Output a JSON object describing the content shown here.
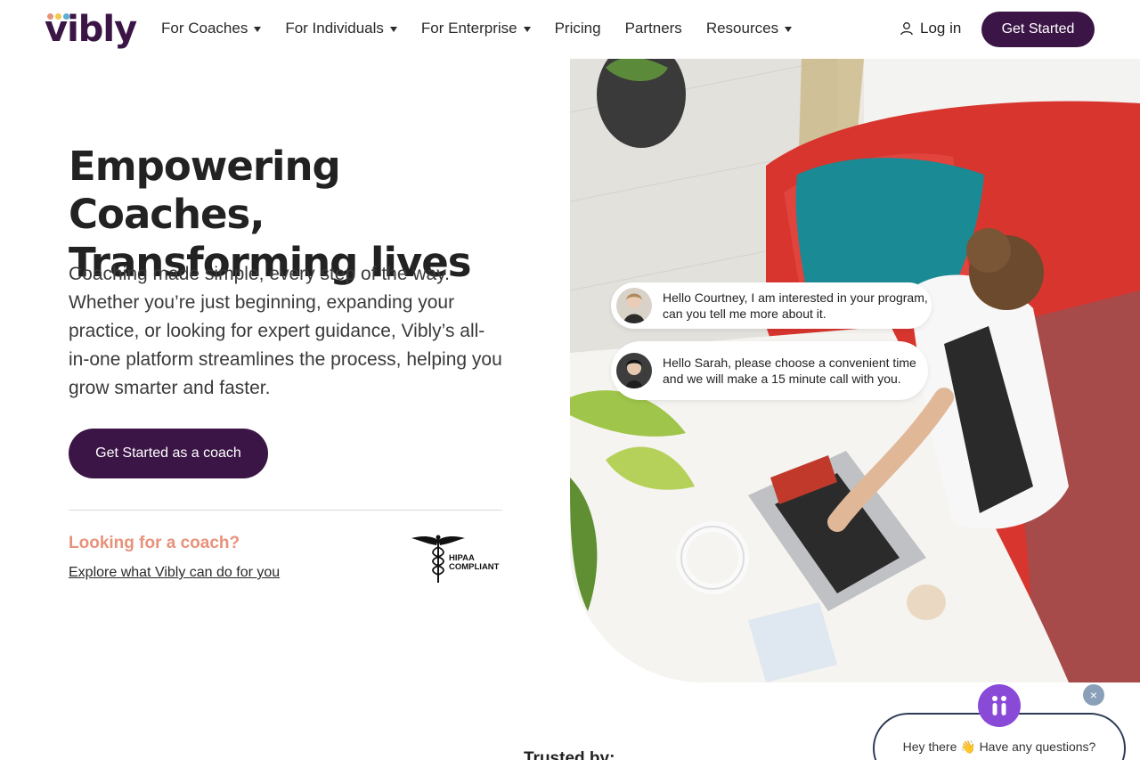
{
  "brand": {
    "name": "vibly",
    "primary_color": "#3b1545",
    "accent_color": "#e8927a"
  },
  "nav": {
    "items": [
      {
        "label": "For Coaches",
        "dropdown": true
      },
      {
        "label": "For Individuals",
        "dropdown": true
      },
      {
        "label": "For Enterprise",
        "dropdown": true
      },
      {
        "label": "Pricing",
        "dropdown": false
      },
      {
        "label": "Partners",
        "dropdown": false
      },
      {
        "label": "Resources",
        "dropdown": true
      }
    ],
    "login_label": "Log in",
    "cta_label": "Get Started"
  },
  "hero": {
    "title_line1": "Empowering Coaches,",
    "title_line2": "Transforming lives",
    "description": "Coaching made simple, every step of the way. Whether you’re just beginning, expanding your practice, or looking for expert guidance, Vibly’s all-in-one platform streamlines the process, helping you grow smarter and faster.",
    "cta_label": "Get Started as a coach",
    "looking_label": "Looking for a coach?",
    "explore_link": "Explore what Vibly can do for you",
    "hipaa_line1": "HIPAA",
    "hipaa_line2": "COMPLIANT"
  },
  "chat_bubbles": [
    {
      "text": "Hello Courtney, I am interested in your program, can you tell me more about it."
    },
    {
      "text": "Hello Sarah, please choose a convenient time and we will make a 15 minute call with you."
    }
  ],
  "trusted_label": "Trusted by:",
  "widget": {
    "greeting": "Hey there 👋 Have any questions?",
    "close_symbol": "×"
  }
}
